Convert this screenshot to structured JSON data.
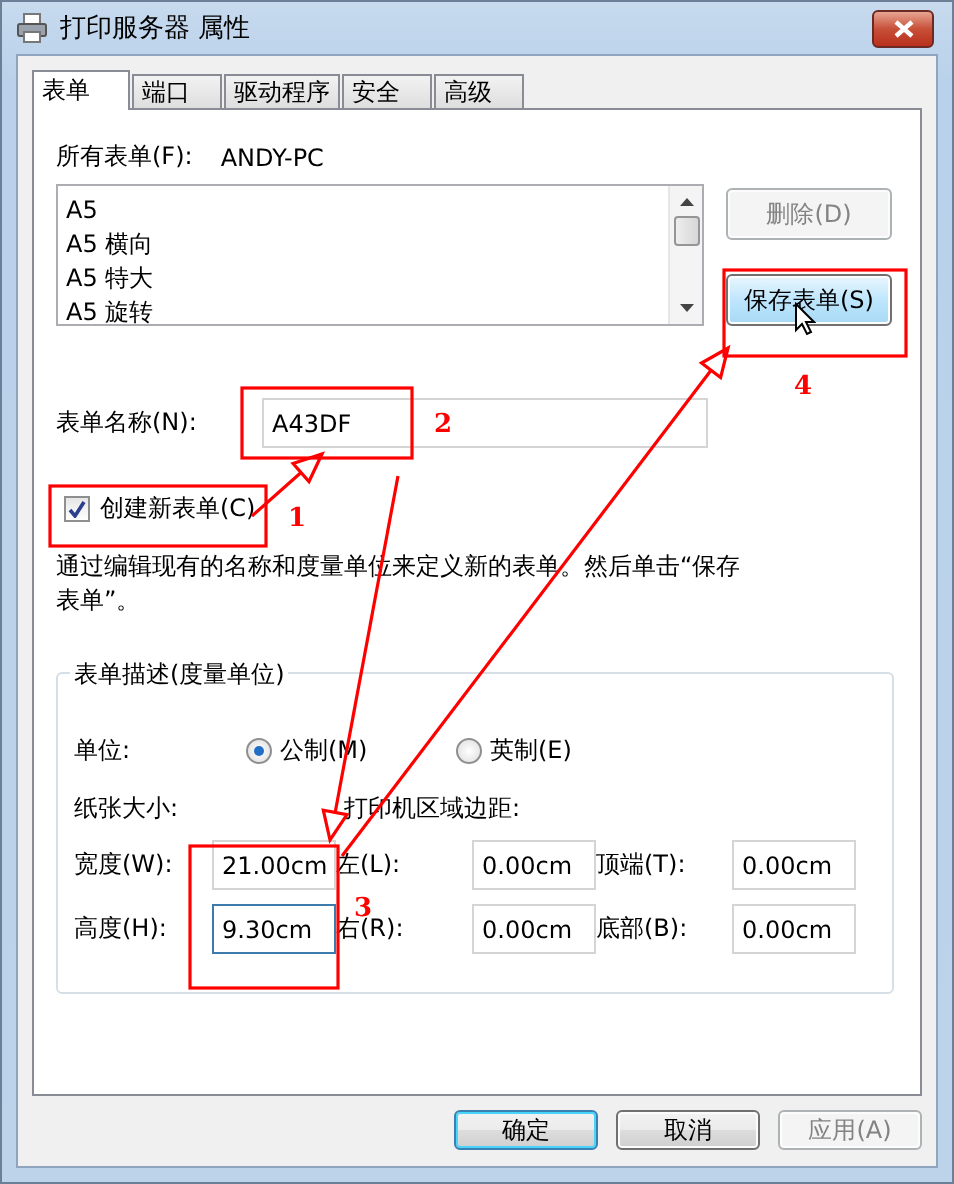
{
  "window": {
    "title": "打印服务器 属性"
  },
  "tabs": [
    {
      "label": "表单",
      "selected": true
    },
    {
      "label": "端口",
      "selected": false
    },
    {
      "label": "驱动程序",
      "selected": false
    },
    {
      "label": "安全",
      "selected": false
    },
    {
      "label": "高级",
      "selected": false
    }
  ],
  "forms": {
    "all_forms_label": "所有表单(F):",
    "server": "ANDY-PC",
    "list": [
      {
        "label": "A5",
        "selected": false
      },
      {
        "label": "A5 横向",
        "selected": false
      },
      {
        "label": "A5 特大",
        "selected": false
      },
      {
        "label": "A5 旋转",
        "selected": false
      }
    ],
    "delete_button": {
      "label": "删除(D)",
      "disabled": true
    },
    "save_button": {
      "label": "保存表单(S)",
      "disabled": false
    },
    "form_name": {
      "label": "表单名称(N):",
      "value": "A43DF"
    },
    "create_new": {
      "label": "创建新表单(C)",
      "checked": true
    },
    "description": "通过编辑现有的名称和度量单位来定义新的表单。然后单击“保存表单”。"
  },
  "measurements": {
    "title": "表单描述(度量单位)",
    "units_label": "单位:",
    "units": [
      {
        "label": "公制(M)",
        "selected": true
      },
      {
        "label": "英制(E)",
        "selected": false
      }
    ],
    "paper_size_label": "纸张大小:",
    "margins_label": "打印机区域边距:",
    "rows": [
      [
        {
          "label": "宽度(W):",
          "value": "21.00cm",
          "focused": false
        },
        {
          "label": "左(L):",
          "value": "0.00cm",
          "focused": false
        },
        {
          "label": "顶端(T):",
          "value": "0.00cm",
          "focused": false
        }
      ],
      [
        {
          "label": "高度(H):",
          "value": "9.30cm",
          "focused": true
        },
        {
          "label": "右(R):",
          "value": "0.00cm",
          "focused": false
        },
        {
          "label": "底部(B):",
          "value": "0.00cm",
          "focused": false
        }
      ]
    ]
  },
  "buttons": [
    {
      "label": "确定",
      "default": true,
      "disabled": false
    },
    {
      "label": "取消",
      "default": false,
      "disabled": false
    },
    {
      "label": "应用(A)",
      "default": false,
      "disabled": true
    }
  ],
  "annotations": [
    {
      "number": "1"
    },
    {
      "number": "2"
    },
    {
      "number": "3"
    },
    {
      "number": "4"
    }
  ]
}
